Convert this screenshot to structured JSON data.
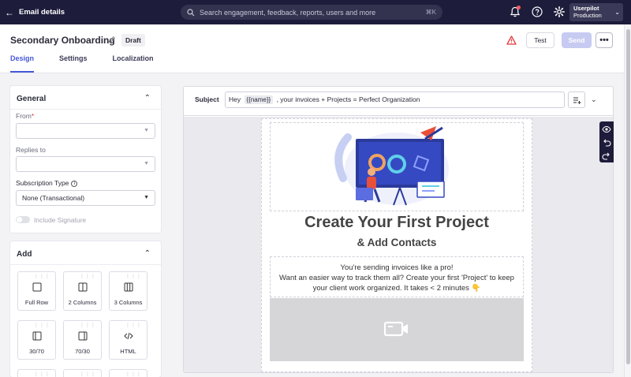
{
  "topbar": {
    "back_label": "Email details",
    "search_placeholder": "Search engagement, feedback, reports, users and more",
    "search_shortcut": "⌘K",
    "env_name": "Userpilot",
    "env_sub": "Production"
  },
  "header": {
    "title": "Secondary Onboarding",
    "status": "Draft",
    "test_label": "Test",
    "send_label": "Send",
    "more_label": "•••",
    "tabs": [
      {
        "label": "Design",
        "active": true
      },
      {
        "label": "Settings",
        "active": false
      },
      {
        "label": "Localization",
        "active": false
      }
    ]
  },
  "general": {
    "heading": "General",
    "from_label": "From",
    "from_required": "*",
    "from_value": "",
    "replies_label": "Replies to",
    "replies_value": "",
    "subscription_label": "Subscription Type",
    "subscription_value": "None (Transactional)",
    "signature_label": "Include Signature",
    "signature_on": false
  },
  "add": {
    "heading": "Add",
    "tiles": [
      "Full Row",
      "2 Columns",
      "3 Columns",
      "30/70",
      "70/30",
      "HTML"
    ]
  },
  "subject": {
    "label": "Subject",
    "prefix": "Hey",
    "token": "{{name}}",
    "suffix": ",  your invoices + Projects = Perfect Organization"
  },
  "email": {
    "heading": "Create Your First Project",
    "subheading": "& Add Contacts",
    "body_line1": "You're sending invoices like a pro!",
    "body_line2": "Want an easier way to track them all? Create your first 'Project' to keep",
    "body_line3": "your client work organized. It takes < 2 minutes 👇"
  },
  "colors": {
    "topbar": "#1d1c3b",
    "accent": "#4458d8",
    "send_disabled": "#c7cbf2",
    "warning": "#e53a3a"
  }
}
